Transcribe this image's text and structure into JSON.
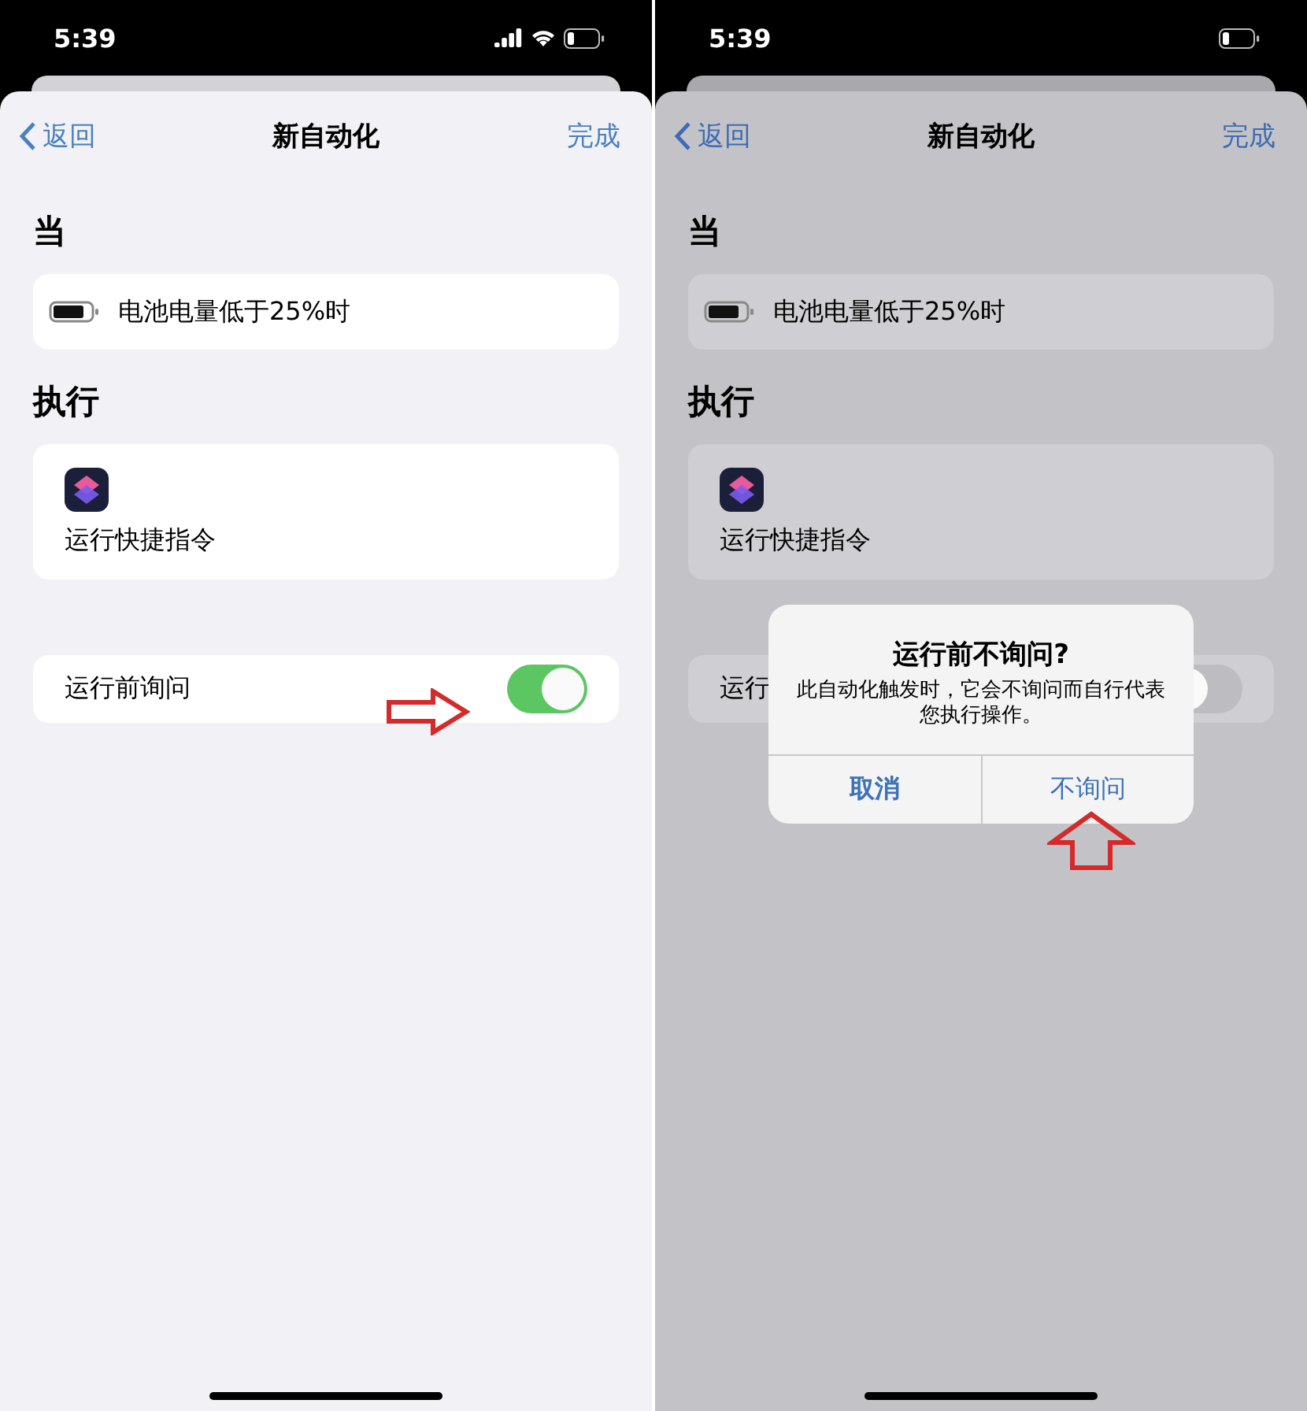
{
  "screens": [
    {
      "dimmed": false,
      "status": {
        "time": "5:39",
        "network_icons": true
      },
      "nav": {
        "back": "返回",
        "title": "新自动化",
        "done": "完成"
      },
      "sections": [
        {
          "header": "当",
          "kind": "trigger",
          "text": "电池电量低于25%时"
        },
        {
          "header": "执行",
          "kind": "action",
          "text": "运行快捷指令"
        }
      ],
      "toggle_row": {
        "label": "运行前询问",
        "on": true
      },
      "annotation": {
        "kind": "arrow_right"
      }
    },
    {
      "dimmed": true,
      "status": {
        "time": "5:39",
        "network_icons": false
      },
      "nav": {
        "back": "返回",
        "title": "新自动化",
        "done": "完成"
      },
      "sections": [
        {
          "header": "当",
          "kind": "trigger",
          "text": "电池电量低于25%时"
        },
        {
          "header": "执行",
          "kind": "action",
          "text": "运行快捷指令"
        }
      ],
      "toggle_row": {
        "label": "运行",
        "on": false
      },
      "dialog": {
        "title": "运行前不询问?",
        "message": "此自动化触发时，它会不询问而自行代表您执行操作。",
        "buttons": [
          {
            "label": "取消",
            "bold": true
          },
          {
            "label": "不询问",
            "bold": false
          }
        ]
      },
      "annotation": {
        "kind": "arrow_up"
      }
    }
  ]
}
